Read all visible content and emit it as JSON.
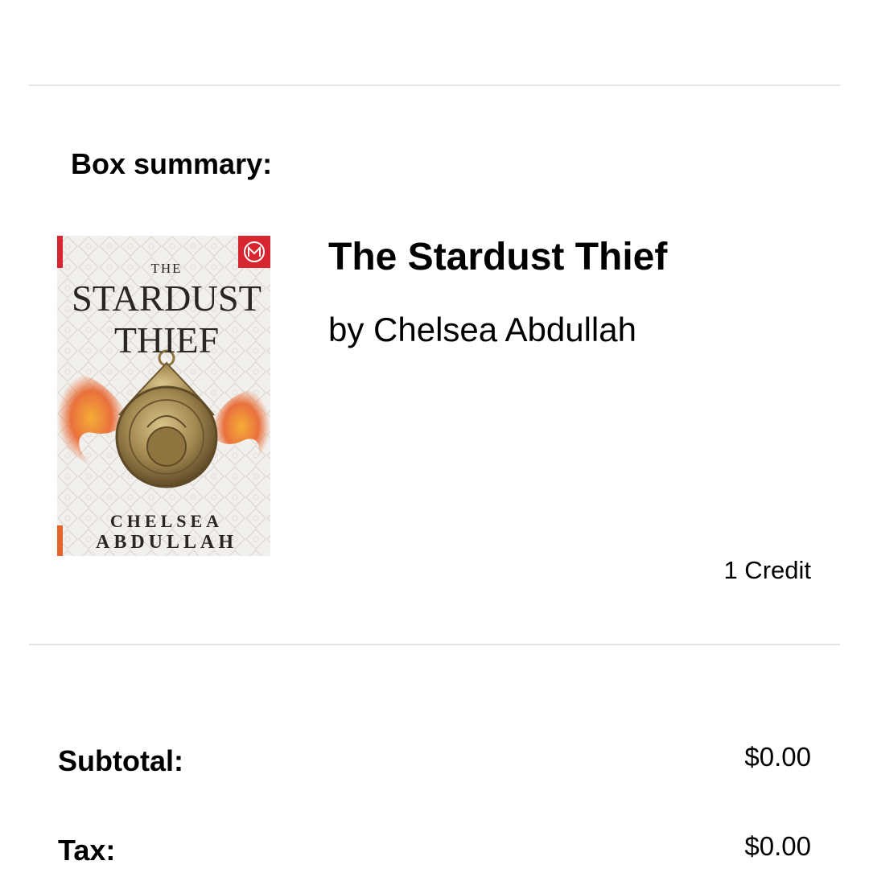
{
  "box_summary": {
    "heading": "Box summary:"
  },
  "item": {
    "title": "The Stardust Thief",
    "author_line": "by Chelsea Abdullah",
    "price": "1 Credit",
    "cover": {
      "title_small": "THE",
      "title_line1": "STARDUST",
      "title_line2": "THIEF",
      "author_first": "CHELSEA",
      "author_last": "ABDULLAH",
      "badge_icon": "botm-badge-icon",
      "accent_color": "#d7262f",
      "flame_color": "#e8632a",
      "medallion_color": "#a58a52"
    }
  },
  "totals": {
    "subtotal_label": "Subtotal:",
    "subtotal_value": "$0.00",
    "tax_label": "Tax:",
    "tax_value": "$0.00"
  }
}
